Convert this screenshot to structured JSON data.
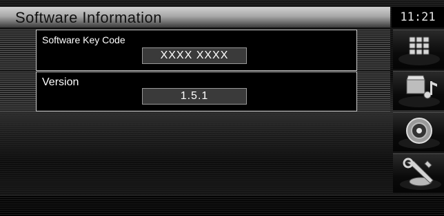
{
  "header": {
    "title": "Software Information",
    "clock": "11:21"
  },
  "software_key": {
    "label": "Software Key Code",
    "value": "XXXX XXXX"
  },
  "version": {
    "label": "Version",
    "value": "1.5.1"
  },
  "side_buttons": [
    {
      "icon": "keypad-icon"
    },
    {
      "icon": "media-icon"
    },
    {
      "icon": "speaker-icon"
    },
    {
      "icon": "settings-tools-icon"
    }
  ]
}
